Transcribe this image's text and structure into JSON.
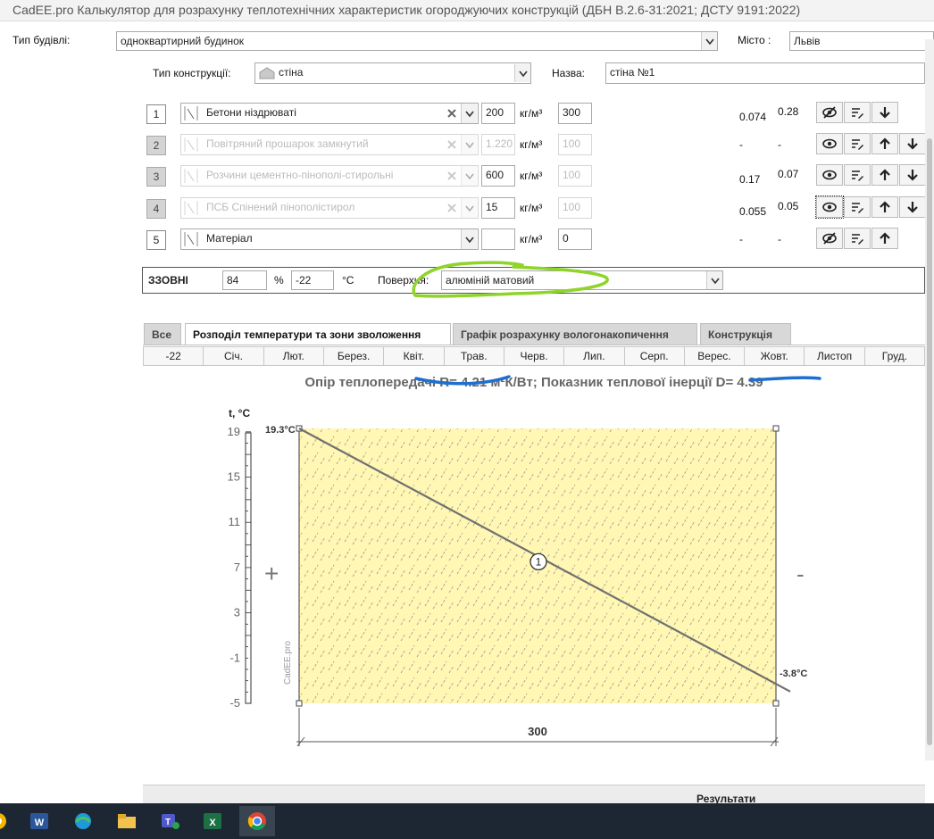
{
  "window": {
    "title": "CadEE.pro Калькулятор для розрахунку теплотехнічних характеристик огороджуючих конструкцій (ДБН В.2.6-31:2021; ДСТУ 9191:2022)"
  },
  "building": {
    "label": "Тип будівлі:",
    "value": "одноквартирний будинок",
    "city_label": "Місто :",
    "city_value": "Львів"
  },
  "construction": {
    "label": "Тип конструкції:",
    "value": "стіна",
    "name_label": "Назва:",
    "name_value": "стіна №1"
  },
  "unit": "кг/м³",
  "layers": [
    {
      "num": "1",
      "material": "Бетони ніздрюваті",
      "thickness": "200",
      "density": "300",
      "v1": "0.074",
      "v2": "0.28",
      "enabled": true,
      "visible": false
    },
    {
      "num": "2",
      "material": "Повітряний прошарок замкнутий",
      "thickness": "1.220",
      "density": "100",
      "v1": "-",
      "v2": "-",
      "enabled": false,
      "visible": true
    },
    {
      "num": "3",
      "material": "Розчини цементно-пінополі-стирольні",
      "thickness": "600",
      "density": "100",
      "v1": "0.17",
      "v2": "0.07",
      "enabled": false,
      "visible": true
    },
    {
      "num": "4",
      "material": "ПСБ Спінений пінополістирол",
      "thickness": "15",
      "density": "100",
      "v1": "0.055",
      "v2": "0.05",
      "enabled": false,
      "visible": true
    },
    {
      "num": "5",
      "material": "Матеріал",
      "thickness": "",
      "density": "0",
      "v1": "-",
      "v2": "-",
      "enabled": true,
      "visible": false
    }
  ],
  "outside": {
    "label": "ЗЗОВНІ",
    "humidity": "84",
    "humidity_unit": "%",
    "temp": "-22",
    "temp_unit": "°C",
    "surface_label": "Поверхня:",
    "surface_value": "алюміній матовий"
  },
  "tabs": [
    {
      "label": "Все",
      "active": false
    },
    {
      "label": "Розподіл температури та зони зволоження",
      "active": true
    },
    {
      "label": "Графік розрахунку вологонакопичення",
      "active": false
    },
    {
      "label": "Конструкція",
      "active": false
    }
  ],
  "months": [
    "-22",
    "Січ.",
    "Лют.",
    "Берез.",
    "Квіт.",
    "Трав.",
    "Черв.",
    "Лип.",
    "Серп.",
    "Верес.",
    "Жовт.",
    "Листоп",
    "Груд."
  ],
  "summary": "Опір теплопередачі R= 4.21 м²К/Вт; Показник теплової інерції D= 4.39",
  "chart_data": {
    "type": "line",
    "ylabel": "t, °C",
    "y_ticks": [
      "19",
      "15",
      "11",
      "7",
      "3",
      "-1",
      "-5"
    ],
    "ylim": [
      -5,
      20.3
    ],
    "series": [
      {
        "x": [
          0,
          300
        ],
        "values": [
          19.3,
          -3.8
        ]
      }
    ],
    "label_inside": "19.3°C",
    "label_outside": "-3.8°C",
    "layer_marker": "1",
    "width_label": "300",
    "inside_sign": "+",
    "outside_sign": "-",
    "watermark": "CadEE.pro",
    "fill_color": "#fff7b3"
  },
  "results_label": "Результати",
  "annotation_color": "#8fd42a",
  "underline_color": "#1d6fd1"
}
